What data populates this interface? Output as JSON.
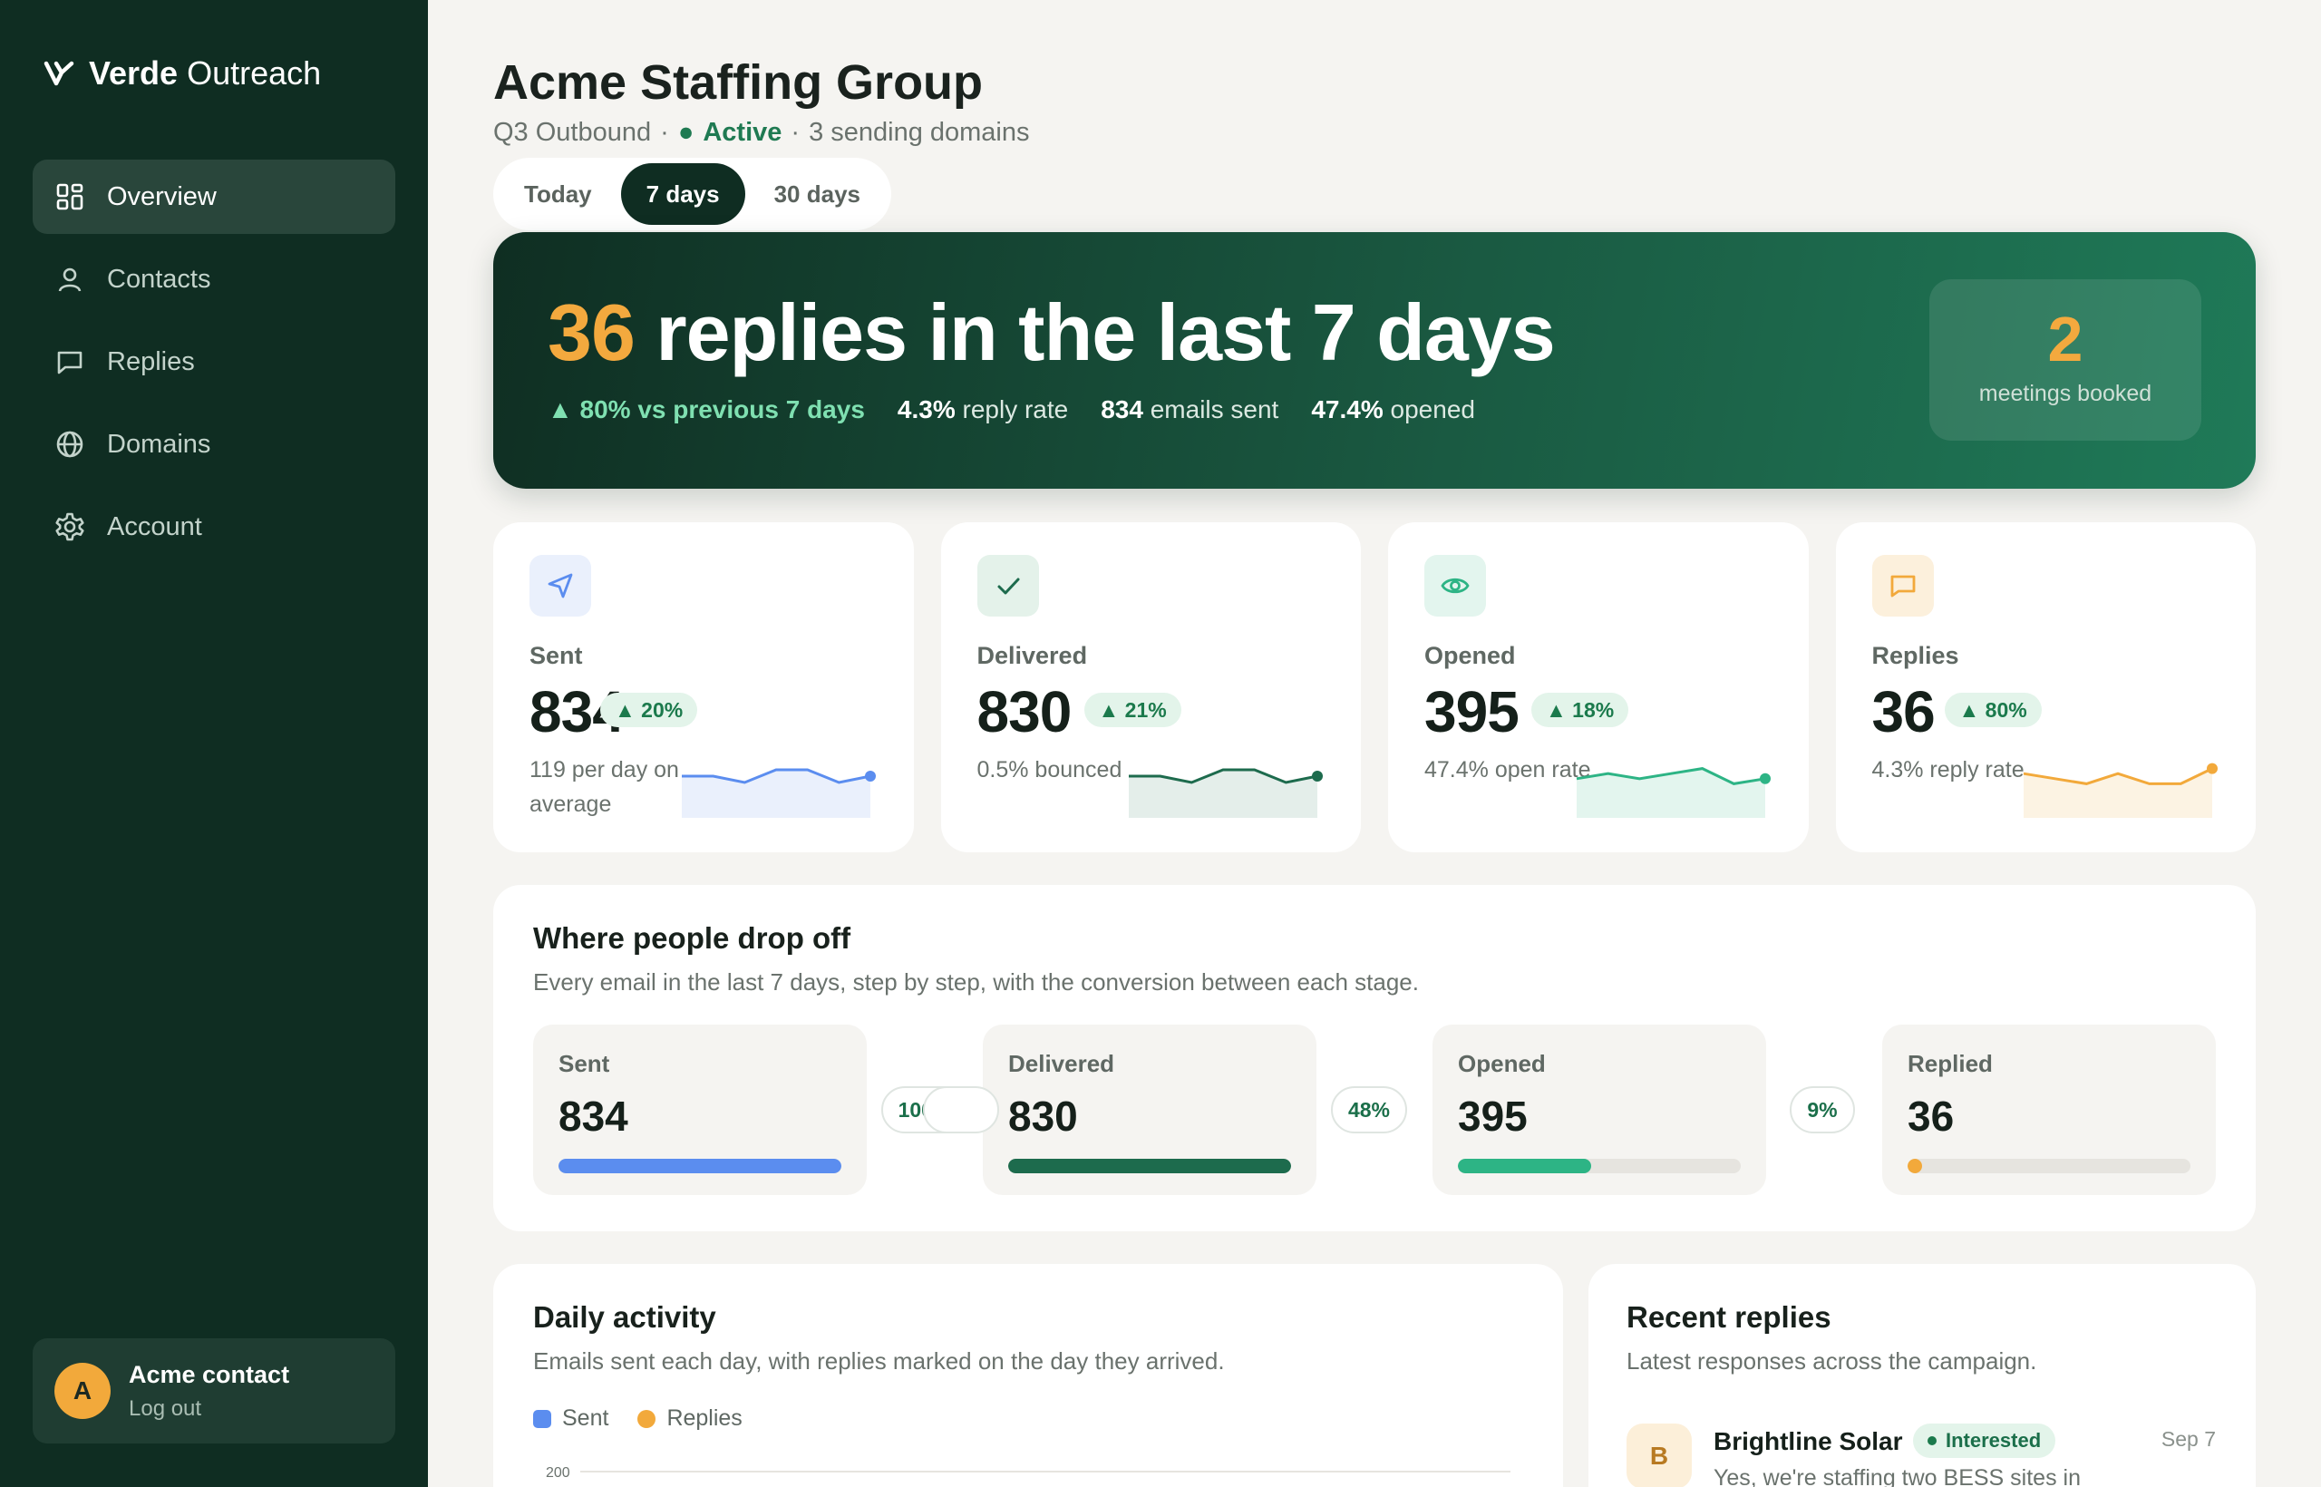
{
  "brand": {
    "name_bold": "Verde",
    "name_rest": "Outreach"
  },
  "nav": [
    {
      "label": "Overview",
      "icon": "grid-icon",
      "active": true
    },
    {
      "label": "Contacts",
      "icon": "person-icon",
      "active": false
    },
    {
      "label": "Replies",
      "icon": "chat-icon",
      "active": false
    },
    {
      "label": "Domains",
      "icon": "globe-icon",
      "active": false
    },
    {
      "label": "Account",
      "icon": "gear-icon",
      "active": false
    }
  ],
  "user": {
    "initial": "A",
    "name": "Acme contact",
    "logout": "Log out"
  },
  "header": {
    "title": "Acme Staffing Group",
    "campaign": "Q3 Outbound",
    "sep1": "·",
    "status_dot": "●",
    "status": "Active",
    "sep2": "·",
    "domains": "3 sending domains"
  },
  "range_tabs": [
    {
      "label": "Today",
      "selected": false
    },
    {
      "label": "7 days",
      "selected": true
    },
    {
      "label": "30 days",
      "selected": false
    }
  ],
  "hero": {
    "headline_num": "36",
    "headline_text": "replies in the last 7 days",
    "trend": "▲ 80% vs previous 7 days",
    "reply_rate_value": "4.3%",
    "reply_rate_label": "reply rate",
    "emails_sent_value": "834",
    "emails_sent_label": "emails sent",
    "opened_value": "47.4%",
    "opened_label": "opened",
    "meetings_value": "2",
    "meetings_label": "meetings booked"
  },
  "stats": [
    {
      "label": "Sent",
      "value": "834",
      "badge": "▲ 20%",
      "note": "119 per day on average",
      "icon": "send-icon",
      "color": "#5b8def",
      "fill": "#eaf0fc",
      "iconbg": "#eaf0fc",
      "spark": [
        5,
        5,
        4,
        6,
        6,
        4,
        5
      ]
    },
    {
      "label": "Delivered",
      "value": "830",
      "badge": "▲ 21%",
      "note": "0.5% bounced",
      "icon": "check-icon",
      "color": "#1d6b4d",
      "fill": "#e4eeea",
      "iconbg": "#e4f2ea",
      "spark": [
        5,
        5,
        4,
        6,
        6,
        4,
        5
      ]
    },
    {
      "label": "Opened",
      "value": "395",
      "badge": "▲ 18%",
      "note": "47.4% open rate",
      "icon": "eye-icon",
      "color": "#2db485",
      "fill": "#e3f5ee",
      "iconbg": "#e3f5ee",
      "spark": [
        4,
        5,
        4,
        5,
        6,
        3,
        4
      ]
    },
    {
      "label": "Replies",
      "value": "36",
      "badge": "▲ 80%",
      "note": "4.3% reply rate",
      "icon": "message-icon",
      "color": "#f2a93b",
      "fill": "#fcf3e3",
      "iconbg": "#fcf0dc",
      "spark": [
        5,
        4,
        3,
        5,
        3,
        3,
        6
      ]
    }
  ],
  "funnel": {
    "title": "Where people drop off",
    "subtitle": "Every email in the last 7 days, step by step, with the conversion between each stage.",
    "steps": [
      {
        "label": "Sent",
        "value": "834",
        "progress": 1.0,
        "color": "#5b8def"
      },
      {
        "label": "Delivered",
        "value": "830",
        "progress": 1.0,
        "color": "#1d6b4d"
      },
      {
        "label": "Opened",
        "value": "395",
        "progress": 0.47,
        "color": "#2db485"
      },
      {
        "label": "Replied",
        "value": "36",
        "progress": 0.04,
        "color": "#f2a93b"
      }
    ],
    "conversions": [
      "100%",
      "48%",
      "9%"
    ]
  },
  "daily": {
    "title": "Daily activity",
    "subtitle": "Emails sent each day, with replies marked on the day they arrived.",
    "legend_sent": "Sent",
    "legend_replies": "Replies",
    "tick_top": "200"
  },
  "recent": {
    "title": "Recent replies",
    "subtitle": "Latest responses across the campaign.",
    "item": {
      "initial": "B",
      "name": "Brightline Solar",
      "badge": "Interested",
      "date": "Sep 7",
      "snippet": "Yes, we're staffing two BESS sites in"
    }
  }
}
